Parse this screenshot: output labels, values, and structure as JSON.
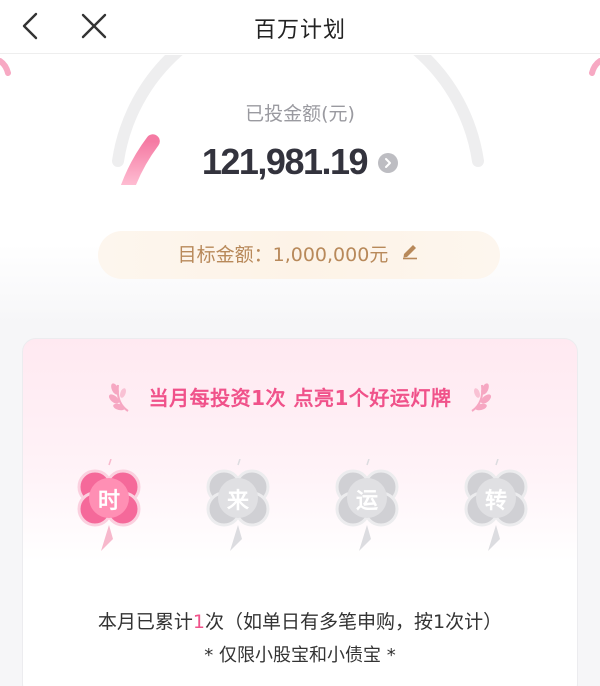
{
  "nav": {
    "title": "百万计划",
    "back_icon": "chevron-left-icon",
    "close_icon": "close-icon"
  },
  "summary": {
    "invested_label": "已投金额(元)",
    "invested_amount": "121,981.19",
    "target_label": "目标金额：1,000,000元",
    "gauge_progress": 0.122
  },
  "card": {
    "title": "当月每投资1次 点亮1个好运灯牌",
    "clovers": [
      {
        "char": "时",
        "lit": true
      },
      {
        "char": "来",
        "lit": false
      },
      {
        "char": "运",
        "lit": false
      },
      {
        "char": "转",
        "lit": false
      }
    ],
    "monthly_prefix": "本月已累计",
    "monthly_count": "1",
    "monthly_suffix": "次（如单日有多笔申购，按1次计）",
    "restriction": "* 仅限小股宝和小债宝 *"
  },
  "colors": {
    "accent_pink": "#f0528a",
    "gold_text": "#b8895a",
    "unlit_gray": "#cfcfd3"
  }
}
